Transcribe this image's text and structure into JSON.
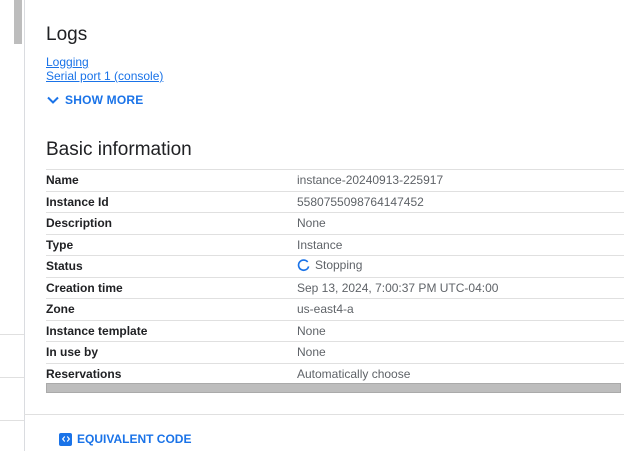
{
  "logs": {
    "title": "Logs",
    "links": [
      "Logging",
      "Serial port 1 (console)"
    ],
    "show_more": "SHOW MORE"
  },
  "basic": {
    "title": "Basic information",
    "rows": [
      {
        "key": "Name",
        "value": "instance-20240913-225917"
      },
      {
        "key": "Instance Id",
        "value": "5580755098764147452"
      },
      {
        "key": "Description",
        "value": "None"
      },
      {
        "key": "Type",
        "value": "Instance"
      },
      {
        "key": "Status",
        "value": "Stopping"
      },
      {
        "key": "Creation time",
        "value": "Sep 13, 2024, 7:00:37 PM UTC-04:00"
      },
      {
        "key": "Zone",
        "value": "us-east4-a"
      },
      {
        "key": "Instance template",
        "value": "None"
      },
      {
        "key": "In use by",
        "value": "None"
      },
      {
        "key": "Reservations",
        "value": "Automatically choose"
      }
    ]
  },
  "footer": {
    "equivalent_code": "EQUIVALENT CODE"
  },
  "colors": {
    "link": "#1a73e8",
    "border": "#e0e0e0",
    "muted_text": "#5f6368"
  },
  "icons": {
    "show_more": "chevron-down-icon",
    "status": "spinner-icon",
    "equivalent_code": "code-icon"
  }
}
